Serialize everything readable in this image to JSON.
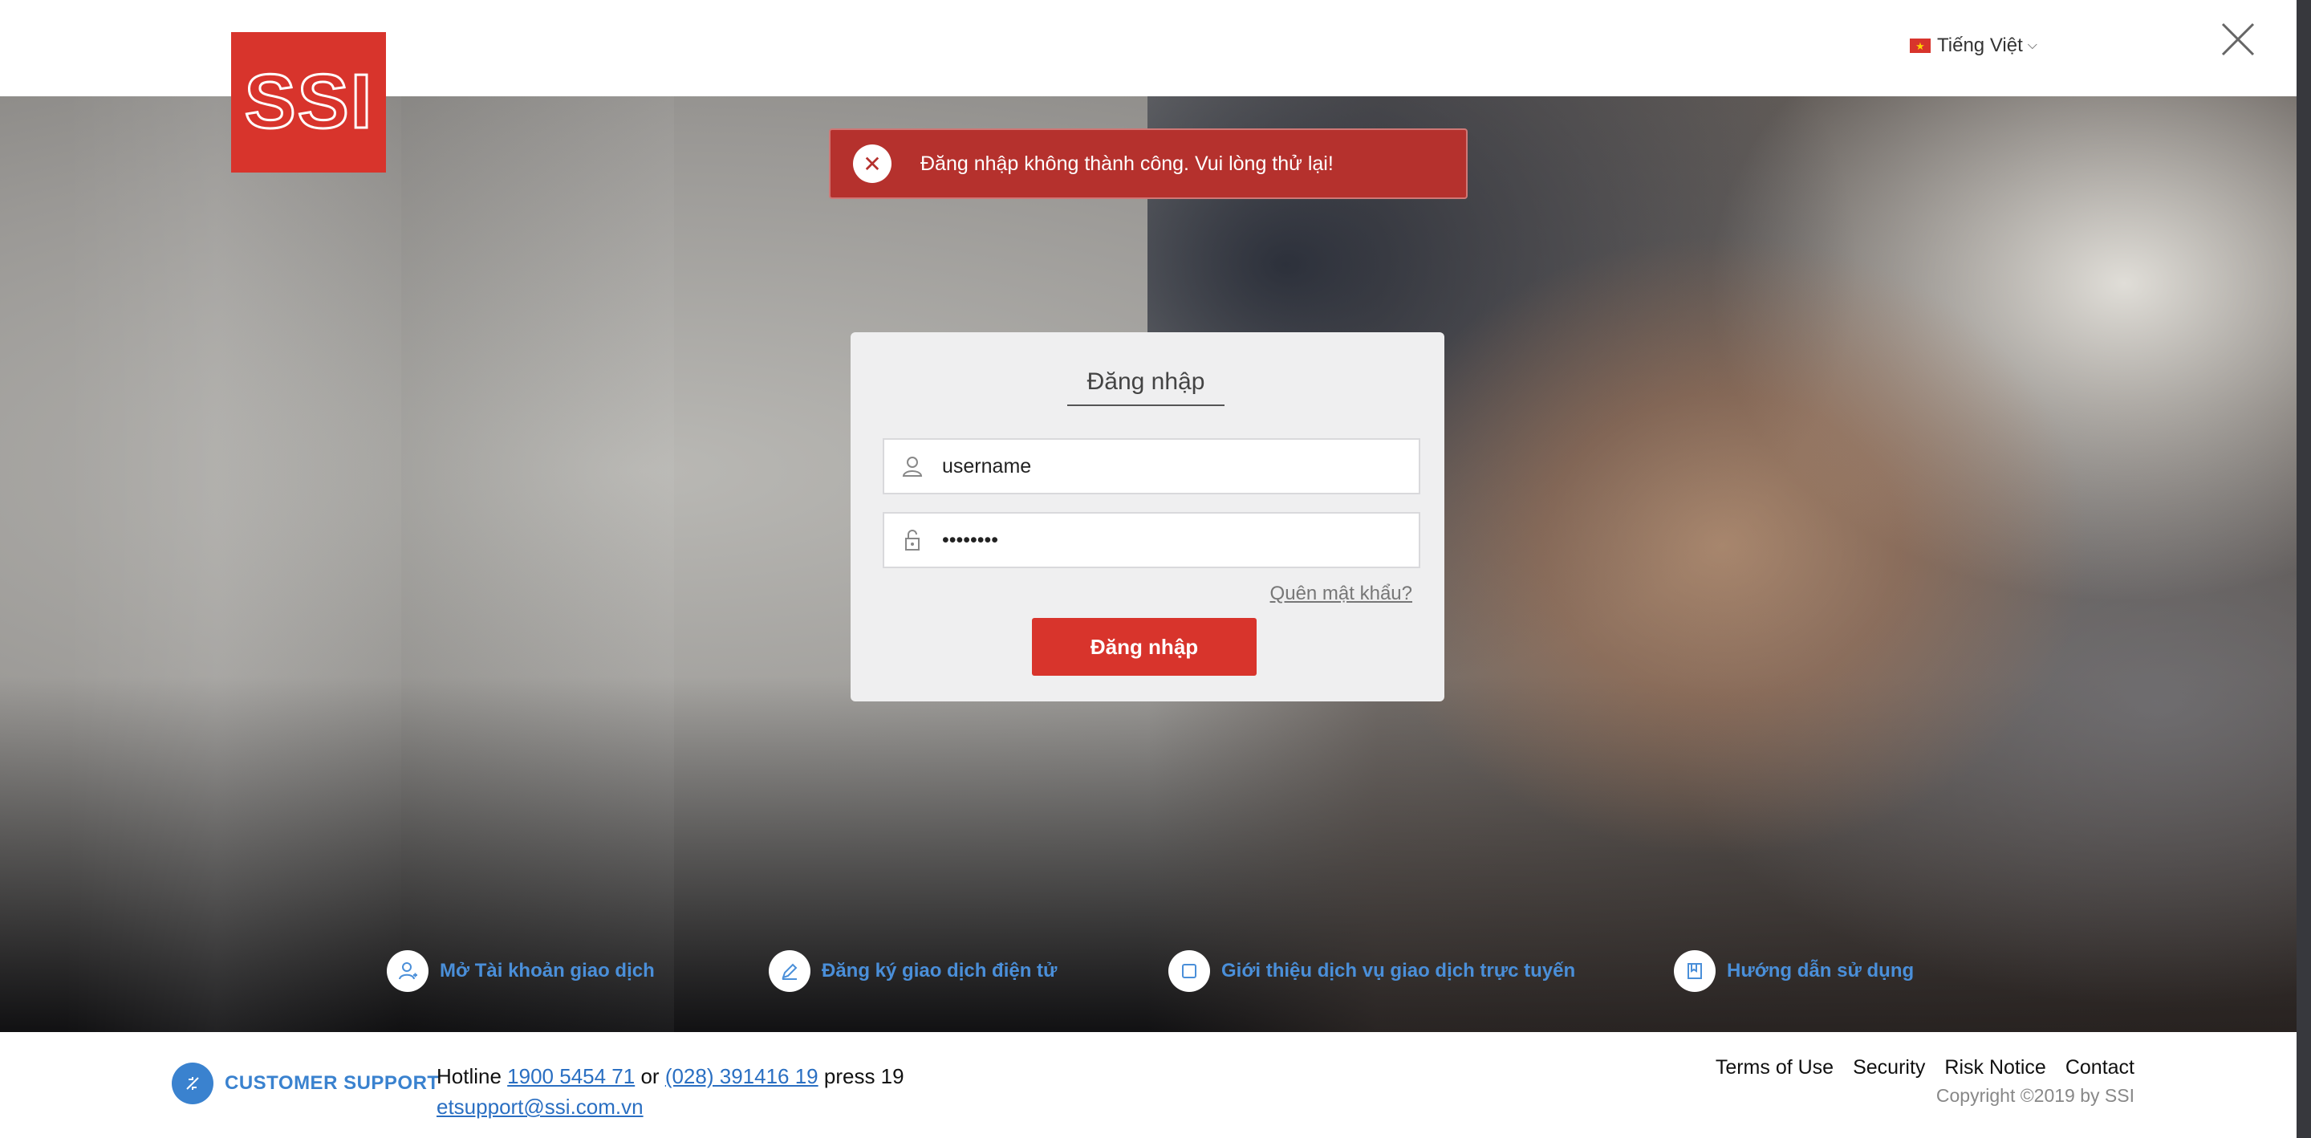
{
  "header": {
    "logo_text": "SSI",
    "language": "Tiếng Việt",
    "flag_icon": "vietnam-flag-icon",
    "close_icon": "close-icon"
  },
  "alert": {
    "message": "Đăng nhập không thành công. Vui lòng thử lại!",
    "icon": "error-x-icon",
    "color": "#b5312d"
  },
  "login": {
    "title": "Đăng nhập",
    "username_value": "username",
    "username_icon": "user-icon",
    "password_value": "••••••••",
    "password_icon": "lock-icon",
    "forgot_link": "Quên mật khẩu?",
    "submit_label": "Đăng nhập",
    "accent_color": "#d8342c"
  },
  "quick_links": [
    {
      "label": "Mở Tài khoản giao dịch",
      "icon": "add-user-icon"
    },
    {
      "label": "Đăng ký giao dịch điện tử",
      "icon": "pencil-icon"
    },
    {
      "label": "Giới thiệu dịch vụ giao dịch trực tuyến",
      "icon": "square-icon"
    },
    {
      "label": "Hướng dẫn sử dụng",
      "icon": "guide-book-icon"
    }
  ],
  "footer": {
    "support_title": "CUSTOMER SUPPORT",
    "support_icon": "phone-support-icon",
    "hotline_prefix": "Hotline",
    "hotline_number_1": "1900 5454 71",
    "hotline_or": "or",
    "hotline_number_2": "(028) 391416 19",
    "hotline_suffix": "press 19",
    "email": "etsupport@ssi.com.vn",
    "links": [
      "Terms of Use",
      "Security",
      "Risk Notice",
      "Contact"
    ],
    "copyright": "Copyright ©2019 by SSI"
  }
}
